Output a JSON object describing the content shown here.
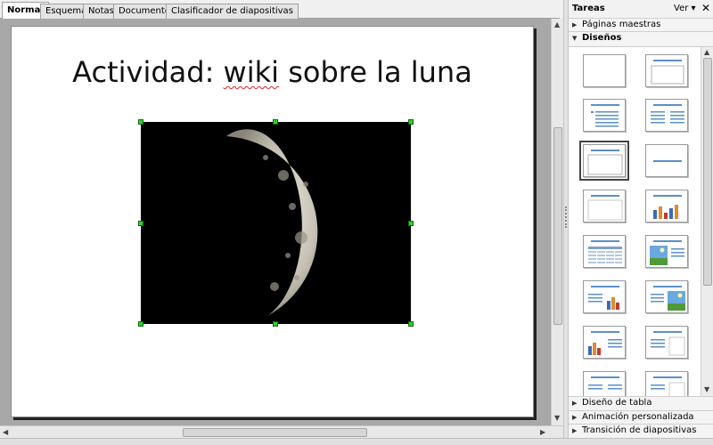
{
  "tabs": [
    {
      "label": "Normal",
      "active": true
    },
    {
      "label": "Esquema"
    },
    {
      "label": "Notas"
    },
    {
      "label": "Documento"
    },
    {
      "label": "Clasificador de diapositivas"
    }
  ],
  "slide": {
    "title_prefix": "Actividad: ",
    "title_misspelled": "wiki",
    "title_suffix": " sobre la luna",
    "image": "moon-photo"
  },
  "task_pane": {
    "title": "Tareas",
    "view_label": "Ver",
    "view_caret": "▾",
    "close_label": "✕",
    "sections_top": [
      {
        "label": "Páginas maestras",
        "open": false
      },
      {
        "label": "Diseños",
        "open": true
      }
    ],
    "layouts": [
      "blank",
      "title-only-top",
      "title-content",
      "title-2-content",
      "title-only",
      "centered-text",
      "title-blank",
      "title-chart",
      "title-table",
      "title-image-text",
      "title-text-chart",
      "title-text-image",
      "title-chart-text",
      "title-text-2",
      "title-2-text-lower",
      "title-text-lower-2"
    ],
    "selected_layout": "title-only",
    "sections_bottom": [
      {
        "label": "Diseño de tabla"
      },
      {
        "label": "Animación personalizada"
      },
      {
        "label": "Transición de diapositivas"
      }
    ]
  },
  "colors": {
    "accent_selection_handle": "#2bd12b",
    "title_bar_blue": "#5b8fc8"
  }
}
